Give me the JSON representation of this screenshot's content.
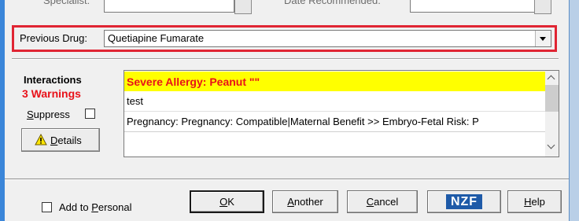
{
  "top_row": {
    "specialist_label": "Specialist:",
    "date_label": "Date Recommended:"
  },
  "previous_drug": {
    "label": "Previous Drug:",
    "value": "Quetiapine Fumarate"
  },
  "interactions": {
    "title": "Interactions",
    "warnings": "3 Warnings",
    "suppress_label": "Suppress",
    "suppress_checked": false,
    "details_label": "Details",
    "rows": [
      {
        "text": "Severe Allergy: Peanut \"\""
      },
      {
        "text": "test"
      },
      {
        "text": "Pregnancy: Pregnancy: Compatible|Maternal Benefit >> Embryo-Fetal Risk: P"
      }
    ],
    "highlight_color": "#ffff00",
    "warning_color": "#e8121a"
  },
  "footer": {
    "add_to_personal": "Add to Personal",
    "add_checked": false,
    "ok": "OK",
    "another": "Another",
    "cancel": "Cancel",
    "nzf": "NZF",
    "help": "Help"
  },
  "icons": {
    "details": "warning-triangle-icon",
    "combo": "chevron-down-icon",
    "scroll_up": "chevron-up-icon",
    "scroll_down": "chevron-down-icon"
  },
  "accent_colors": {
    "highlight_frame": "#e02533",
    "window_frame": "#3b86d9",
    "nzf_badge": "#1e5aa8"
  }
}
